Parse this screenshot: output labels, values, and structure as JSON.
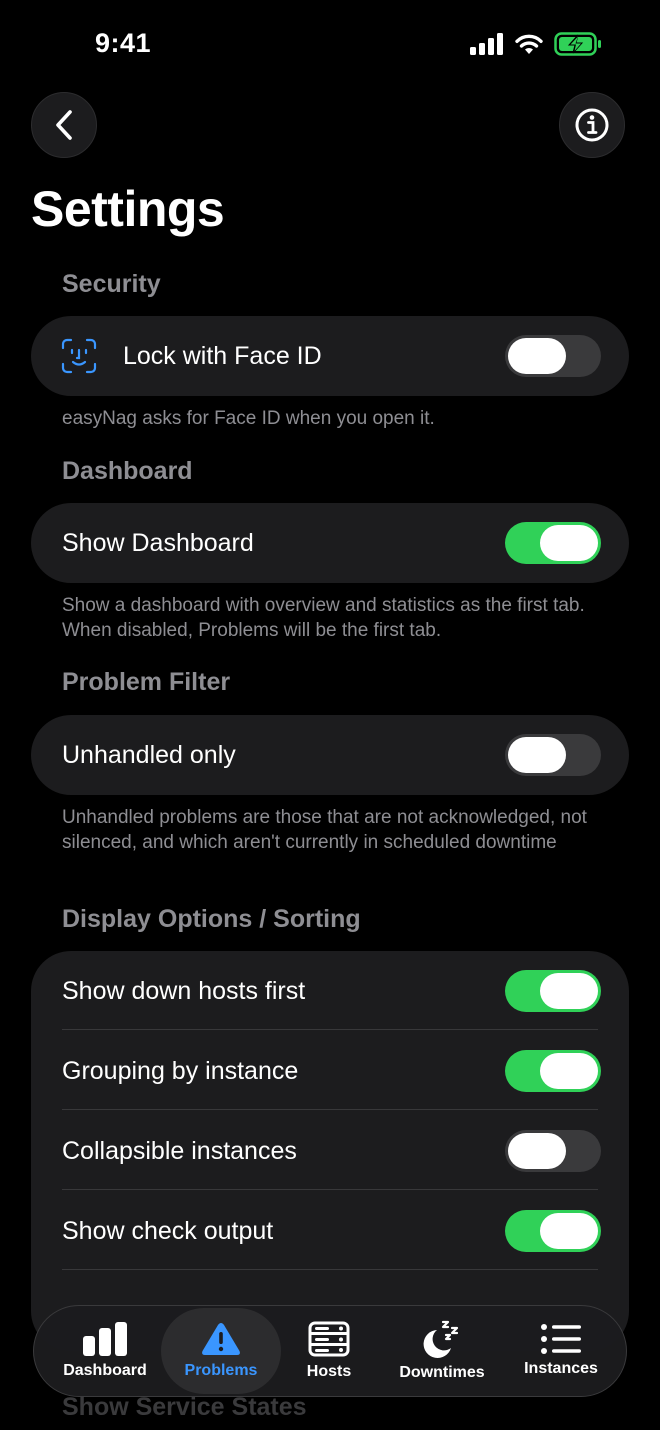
{
  "status_bar": {
    "time": "9:41"
  },
  "page": {
    "title": "Settings"
  },
  "sections": {
    "security": {
      "header": "Security",
      "face_id_label": "Lock with Face ID",
      "face_id_on": false,
      "footnote": "easyNag asks for Face ID when you open it."
    },
    "dashboard": {
      "header": "Dashboard",
      "show_dashboard_label": "Show Dashboard",
      "show_dashboard_on": true,
      "footnote": "Show a dashboard with overview and statistics as the first tab. When disabled, Problems will be the first tab."
    },
    "problem_filter": {
      "header": "Problem Filter",
      "unhandled_label": "Unhandled only",
      "unhandled_on": false,
      "footnote": "Unhandled problems are those that are not acknowledged, not silenced, and which aren't currently in scheduled downtime"
    },
    "display": {
      "header": "Display Options / Sorting",
      "items": [
        {
          "label": "Show down hosts first",
          "on": true
        },
        {
          "label": "Grouping by instance",
          "on": true
        },
        {
          "label": "Collapsible instances",
          "on": false
        },
        {
          "label": "Show check output",
          "on": true
        }
      ]
    },
    "service_states": {
      "header": "Show Service States"
    }
  },
  "tabbar": {
    "tabs": [
      {
        "label": "Dashboard",
        "icon": "chart-bars-icon",
        "active": false
      },
      {
        "label": "Problems",
        "icon": "warning-triangle-icon",
        "active": true
      },
      {
        "label": "Hosts",
        "icon": "server-icon",
        "active": false
      },
      {
        "label": "Downtimes",
        "icon": "moon-zzz-icon",
        "active": false
      },
      {
        "label": "Instances",
        "icon": "list-icon",
        "active": false
      }
    ]
  },
  "colors": {
    "toggle_on": "#30d158",
    "accent": "#3a96ff",
    "card_bg": "#1c1c1e",
    "secondary_text": "#8e8e93"
  }
}
